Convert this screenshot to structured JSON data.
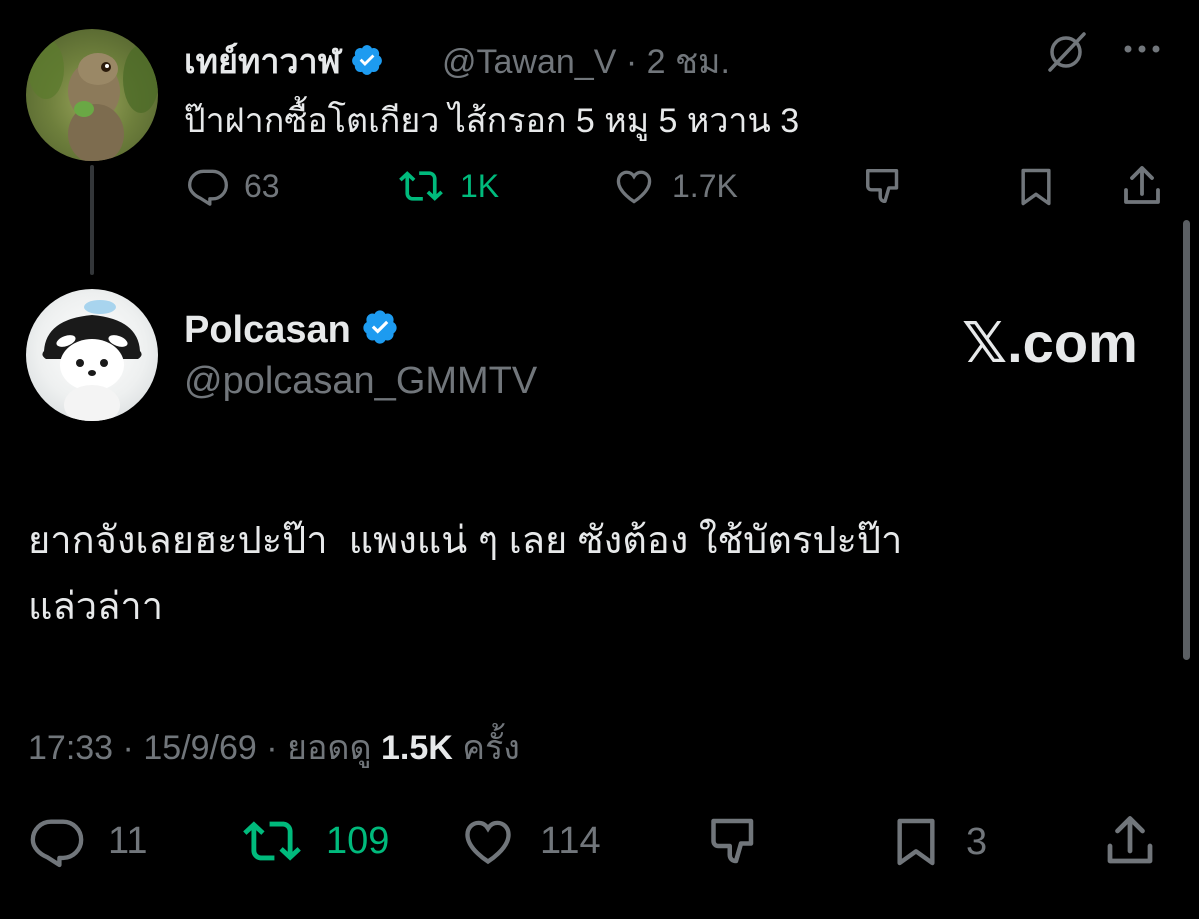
{
  "quoted_tweet": {
    "display_name": "เทย์ทาวาฬ",
    "handle": "@Tawan_V",
    "separator": "·",
    "time_ago": "2 ชม.",
    "text": "ป๊าฝากซื้อโตเกียว ไส้กรอก 5 หมู 5 หวาน 3",
    "actions": {
      "replies": "63",
      "reposts": "1K",
      "likes": "1.7K"
    }
  },
  "main_tweet": {
    "display_name": "Polcasan",
    "handle": "@polcasan_GMMTV",
    "site_label": "𝕏.com",
    "text_line1": "ยากจังเลยฮะปะป๊า  แพงแน่ ๆ เลย ซังต้อง ใช้บัตรปะป๊า",
    "text_line2": "แล่วล่าา",
    "meta": {
      "time": "17:33",
      "date": "15/9/69",
      "views_label": "ยอดดู",
      "views": "1.5K",
      "views_suffix": "ครั้ง",
      "separator": "·"
    },
    "actions": {
      "replies": "11",
      "reposts": "109",
      "likes": "114",
      "bookmarks": "3"
    }
  },
  "colors": {
    "background": "#000000",
    "text": "#e7e9ea",
    "muted": "#71767b",
    "verified": "#1d9bf0",
    "repost_active": "#00ba7c"
  }
}
